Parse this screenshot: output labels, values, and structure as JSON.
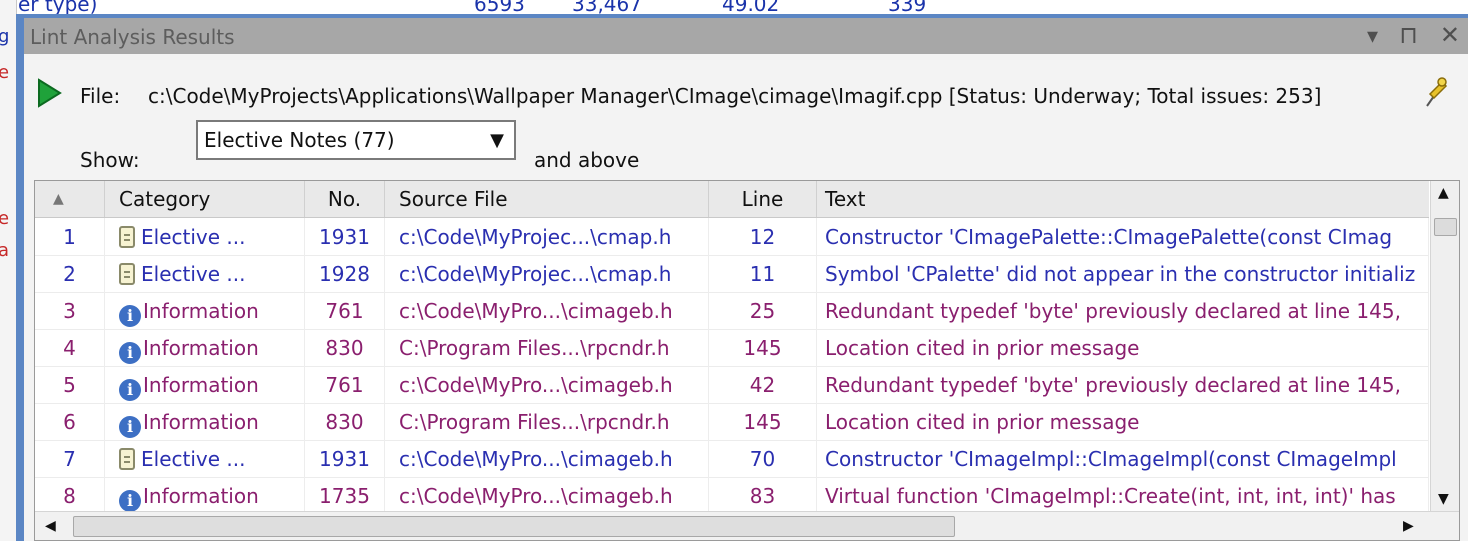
{
  "background": {
    "top_cells": [
      "er type)",
      "6593",
      "33,467",
      "49.02",
      "339"
    ]
  },
  "window": {
    "title": "Lint Analysis Results",
    "buttons": {
      "dropdown": "▾",
      "pin": "⊓",
      "close": "✕"
    }
  },
  "file_bar": {
    "label": "File:",
    "path": "c:\\Code\\MyProjects\\Applications\\Wallpaper Manager\\CImage\\cimage\\Imagif.cpp [Status: Underway; Total issues: 253]"
  },
  "filter": {
    "label": "Show:",
    "selected": "Elective Notes (77)",
    "suffix": "and above"
  },
  "table": {
    "columns": [
      "",
      "Category",
      "No.",
      "Source File",
      "Line",
      "Text"
    ],
    "rows": [
      {
        "idx": "1",
        "icon": "note",
        "category": "Elective ...",
        "no": "1931",
        "source": "c:\\Code\\MyProjec...\\cmap.h",
        "line": "12",
        "text": "Constructor 'CImagePalette::CImagePalette(const CImag"
      },
      {
        "idx": "2",
        "icon": "note",
        "category": "Elective ...",
        "no": "1928",
        "source": "c:\\Code\\MyProjec...\\cmap.h",
        "line": "11",
        "text": "Symbol 'CPalette' did not appear in the constructor initializ"
      },
      {
        "idx": "3",
        "icon": "info",
        "category": "Information",
        "no": "761",
        "source": "c:\\Code\\MyPro...\\cimageb.h",
        "line": "25",
        "text": "Redundant typedef 'byte' previously declared at line 145,"
      },
      {
        "idx": "4",
        "icon": "info",
        "category": "Information",
        "no": "830",
        "source": "C:\\Program Files...\\rpcndr.h",
        "line": "145",
        "text": "Location cited in prior message"
      },
      {
        "idx": "5",
        "icon": "info",
        "category": "Information",
        "no": "761",
        "source": "c:\\Code\\MyPro...\\cimageb.h",
        "line": "42",
        "text": "Redundant typedef 'byte' previously declared at line 145,"
      },
      {
        "idx": "6",
        "icon": "info",
        "category": "Information",
        "no": "830",
        "source": "C:\\Program Files...\\rpcndr.h",
        "line": "145",
        "text": "Location cited in prior message"
      },
      {
        "idx": "7",
        "icon": "note",
        "category": "Elective ...",
        "no": "1931",
        "source": "c:\\Code\\MyPro...\\cimageb.h",
        "line": "70",
        "text": "Constructor 'CImageImpl::CImageImpl(const CImageImpl"
      },
      {
        "idx": "8",
        "icon": "info",
        "category": "Information",
        "no": "1735",
        "source": "c:\\Code\\MyPro...\\cimageb.h",
        "line": "83",
        "text": "Virtual function 'CImageImpl::Create(int, int, int, int)' has"
      }
    ]
  },
  "colors": {
    "elective": "#2a2fb0",
    "information": "#8a1f6e",
    "frame": "#5b86c4"
  }
}
